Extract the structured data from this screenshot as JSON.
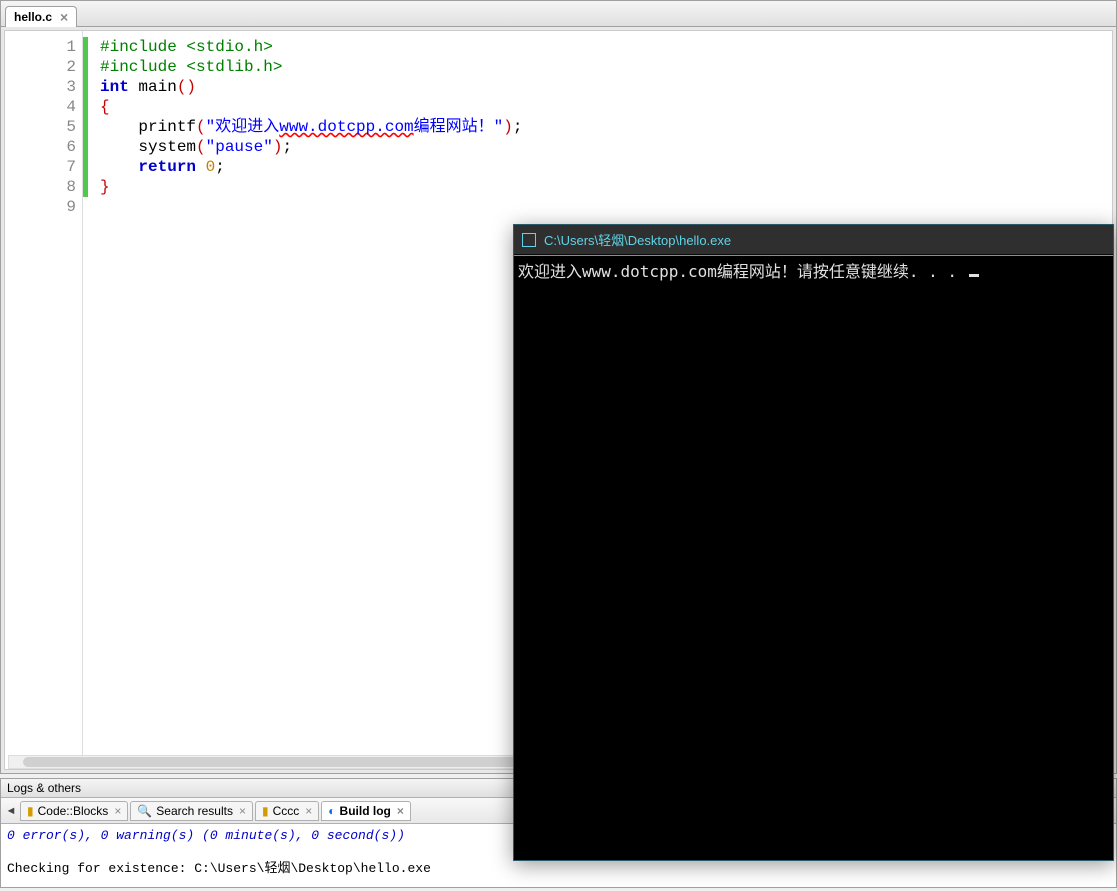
{
  "file_tab": {
    "name": "hello.c"
  },
  "code_lines": [
    {
      "n": 1,
      "tokens": [
        {
          "c": "pp",
          "t": "#include <stdio.h>"
        }
      ]
    },
    {
      "n": 2,
      "tokens": [
        {
          "c": "pp",
          "t": "#include <stdlib.h>"
        }
      ]
    },
    {
      "n": 3,
      "tokens": [
        {
          "c": "kw",
          "t": "int"
        },
        {
          "c": "",
          "t": " main"
        },
        {
          "c": "paren",
          "t": "()"
        }
      ]
    },
    {
      "n": 4,
      "tokens": [
        {
          "c": "brace",
          "t": "{"
        }
      ]
    },
    {
      "n": 5,
      "tokens": [
        {
          "c": "",
          "t": "    printf"
        },
        {
          "c": "paren",
          "t": "("
        },
        {
          "c": "str",
          "t": "\"欢迎进入"
        },
        {
          "c": "strurl",
          "t": "www.dotcpp.com"
        },
        {
          "c": "str",
          "t": "编程网站！\""
        },
        {
          "c": "paren",
          "t": ")"
        },
        {
          "c": "",
          "t": ";"
        }
      ]
    },
    {
      "n": 6,
      "tokens": [
        {
          "c": "",
          "t": "    system"
        },
        {
          "c": "paren",
          "t": "("
        },
        {
          "c": "str",
          "t": "\"pause\""
        },
        {
          "c": "paren",
          "t": ")"
        },
        {
          "c": "",
          "t": ";"
        }
      ]
    },
    {
      "n": 7,
      "tokens": [
        {
          "c": "",
          "t": "    "
        },
        {
          "c": "kw",
          "t": "return"
        },
        {
          "c": "",
          "t": " "
        },
        {
          "c": "num",
          "t": "0"
        },
        {
          "c": "",
          "t": ";"
        }
      ]
    },
    {
      "n": 8,
      "tokens": [
        {
          "c": "brace",
          "t": "}"
        }
      ]
    },
    {
      "n": 9,
      "tokens": []
    }
  ],
  "changed_lines": 8,
  "logs": {
    "title": "Logs & others",
    "tabs": [
      {
        "id": "codeblocks",
        "label": "Code::Blocks",
        "icon": "doc"
      },
      {
        "id": "search",
        "label": "Search results",
        "icon": "search"
      },
      {
        "id": "cccc",
        "label": "Cccc",
        "icon": "doc"
      },
      {
        "id": "buildlog",
        "label": "Build log",
        "icon": "build",
        "active": true
      }
    ],
    "summary": "0 error(s), 0 warning(s) (0 minute(s), 0 second(s))",
    "line2": "Checking for existence: C:\\Users\\轻烟\\Desktop\\hello.exe"
  },
  "console": {
    "title": "C:\\Users\\轻烟\\Desktop\\hello.exe",
    "output": "欢迎进入www.dotcpp.com编程网站！请按任意键继续. . . "
  }
}
